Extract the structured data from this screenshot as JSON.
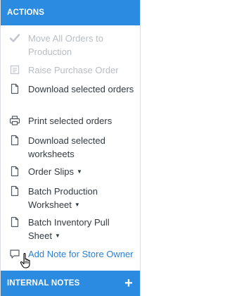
{
  "header": {
    "title": "ACTIONS"
  },
  "items": [
    {
      "label": "Move All Orders to Production",
      "icon": "check-icon",
      "state": "disabled"
    },
    {
      "label": "Raise Purchase Order",
      "icon": "list-document-icon",
      "state": "disabled"
    },
    {
      "label": "Download selected orders",
      "icon": "document-icon",
      "state": "enabled"
    },
    {
      "label": "Print selected orders",
      "icon": "printer-icon",
      "state": "enabled"
    },
    {
      "label": "Download selected worksheets",
      "icon": "document-icon",
      "state": "enabled"
    },
    {
      "label": "Order Slips",
      "icon": "document-icon",
      "state": "enabled",
      "dropdown": "▼"
    },
    {
      "label": "Batch Production Worksheet",
      "icon": "document-icon",
      "state": "enabled",
      "dropdown": "▼"
    },
    {
      "label": "Batch Inventory Pull Sheet",
      "icon": "document-icon",
      "state": "enabled",
      "dropdown": "▼"
    },
    {
      "label": "Add Note for Store Owner",
      "icon": "comment-icon",
      "state": "link"
    }
  ],
  "footer": {
    "title": "INTERNAL NOTES",
    "add_icon": "+"
  },
  "colors": {
    "accent": "#2a8be0",
    "link": "#2a7fd4",
    "disabled": "#b9bec3",
    "text": "#333a40"
  }
}
